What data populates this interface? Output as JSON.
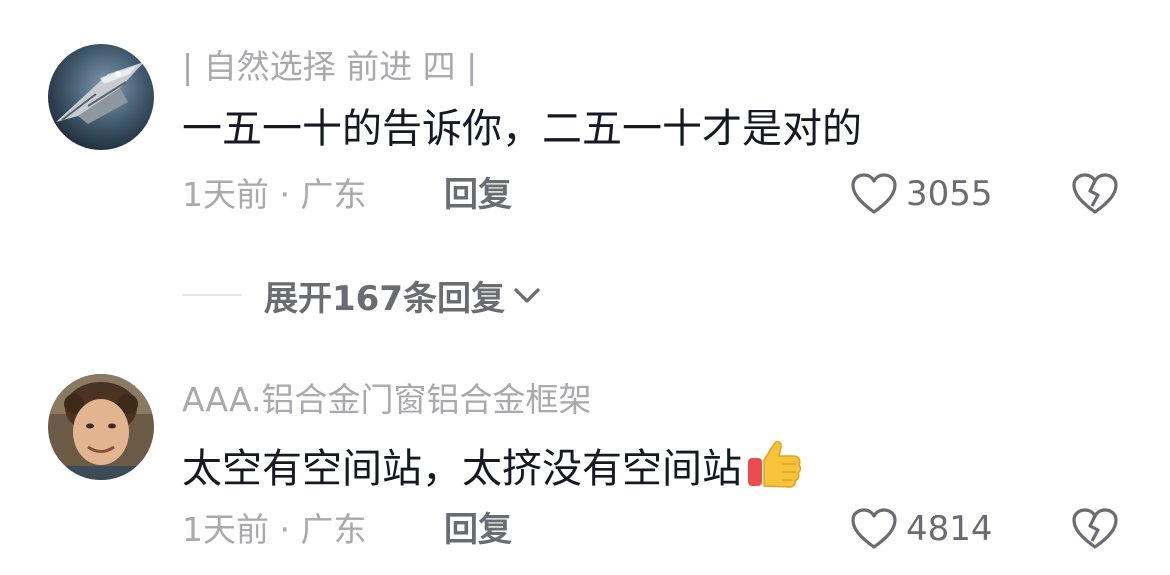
{
  "comments": [
    {
      "username": "| 自然选择 前进 四 |",
      "content": "一五一十的告诉你，二五一十才是对的",
      "meta": "1天前 · 广东",
      "reply_label": "回复",
      "like_count": "3055",
      "avatar_icon": "spaceship-avatar",
      "emoji": ""
    },
    {
      "username": "AAA.铝合金门窗铝合金框架",
      "content": "太空有空间站，太挤没有空间站",
      "meta": "1天前 · 广东",
      "reply_label": "回复",
      "like_count": "4814",
      "avatar_icon": "man-portrait-avatar",
      "emoji": "thumbs-up"
    }
  ],
  "expand_replies": {
    "label": "展开167条回复"
  },
  "icons": {
    "like": "heart-outline-icon",
    "dislike": "broken-heart-icon",
    "expand": "chevron-down-icon"
  },
  "colors": {
    "text_primary": "#161823",
    "text_secondary": "#a9a9ae",
    "text_action": "#6b6b72"
  }
}
